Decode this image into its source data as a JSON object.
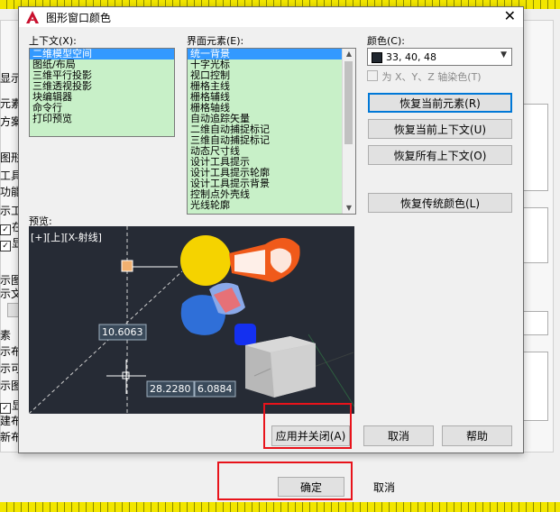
{
  "background": {
    "left_labels": [
      "显示",
      "元素",
      "方案",
      "图形",
      "工具",
      "功能",
      "示工",
      "在",
      "显",
      "示图",
      "示文",
      "素",
      "示布",
      "示可",
      "示图",
      "显示",
      "建布",
      "新布"
    ],
    "ok_label": "确定",
    "cancel_label": "取消"
  },
  "dialog": {
    "title": "图形窗口颜色",
    "close_symbol": "✕",
    "context": {
      "label": "上下文(X):",
      "items": [
        "二维模型空间",
        "图纸/布局",
        "三维平行投影",
        "三维透视投影",
        "块编辑器",
        "命令行",
        "打印预览"
      ],
      "selected": 0
    },
    "interface": {
      "label": "界面元素(E):",
      "items": [
        "统一背景",
        "十字光标",
        "视口控制",
        "栅格主线",
        "栅格辅线",
        "栅格轴线",
        "自动追踪矢量",
        "二维自动捕捉标记",
        "三维自动捕捉标记",
        "动态尺寸线",
        "设计工具提示",
        "设计工具提示轮廓",
        "设计工具提示背景",
        "控制点外壳线",
        "光线轮廓"
      ],
      "selected": 0
    },
    "color": {
      "label": "颜色(C):",
      "value": "33, 40, 48",
      "swatch": "#212830",
      "tint_label": "为 X、Y、Z 轴染色(T)"
    },
    "buttons": {
      "restore_element": "恢复当前元素(R)",
      "restore_context": "恢复当前上下文(U)",
      "restore_all": "恢复所有上下文(O)",
      "restore_classic": "恢复传统颜色(L)",
      "apply_close": "应用并关闭(A)",
      "cancel": "取消",
      "help": "帮助"
    },
    "preview": {
      "label": "预览:",
      "viewport_label": "[+][上][X-射线]",
      "dim1": "10.6063",
      "dim2": "28.2280",
      "dim3": "6.0884"
    }
  },
  "colors": {
    "preview_bg": "#262b35",
    "list_bg": "#c8f0c8",
    "selection": "#3399ff",
    "highlight_red": "#e8131b"
  }
}
